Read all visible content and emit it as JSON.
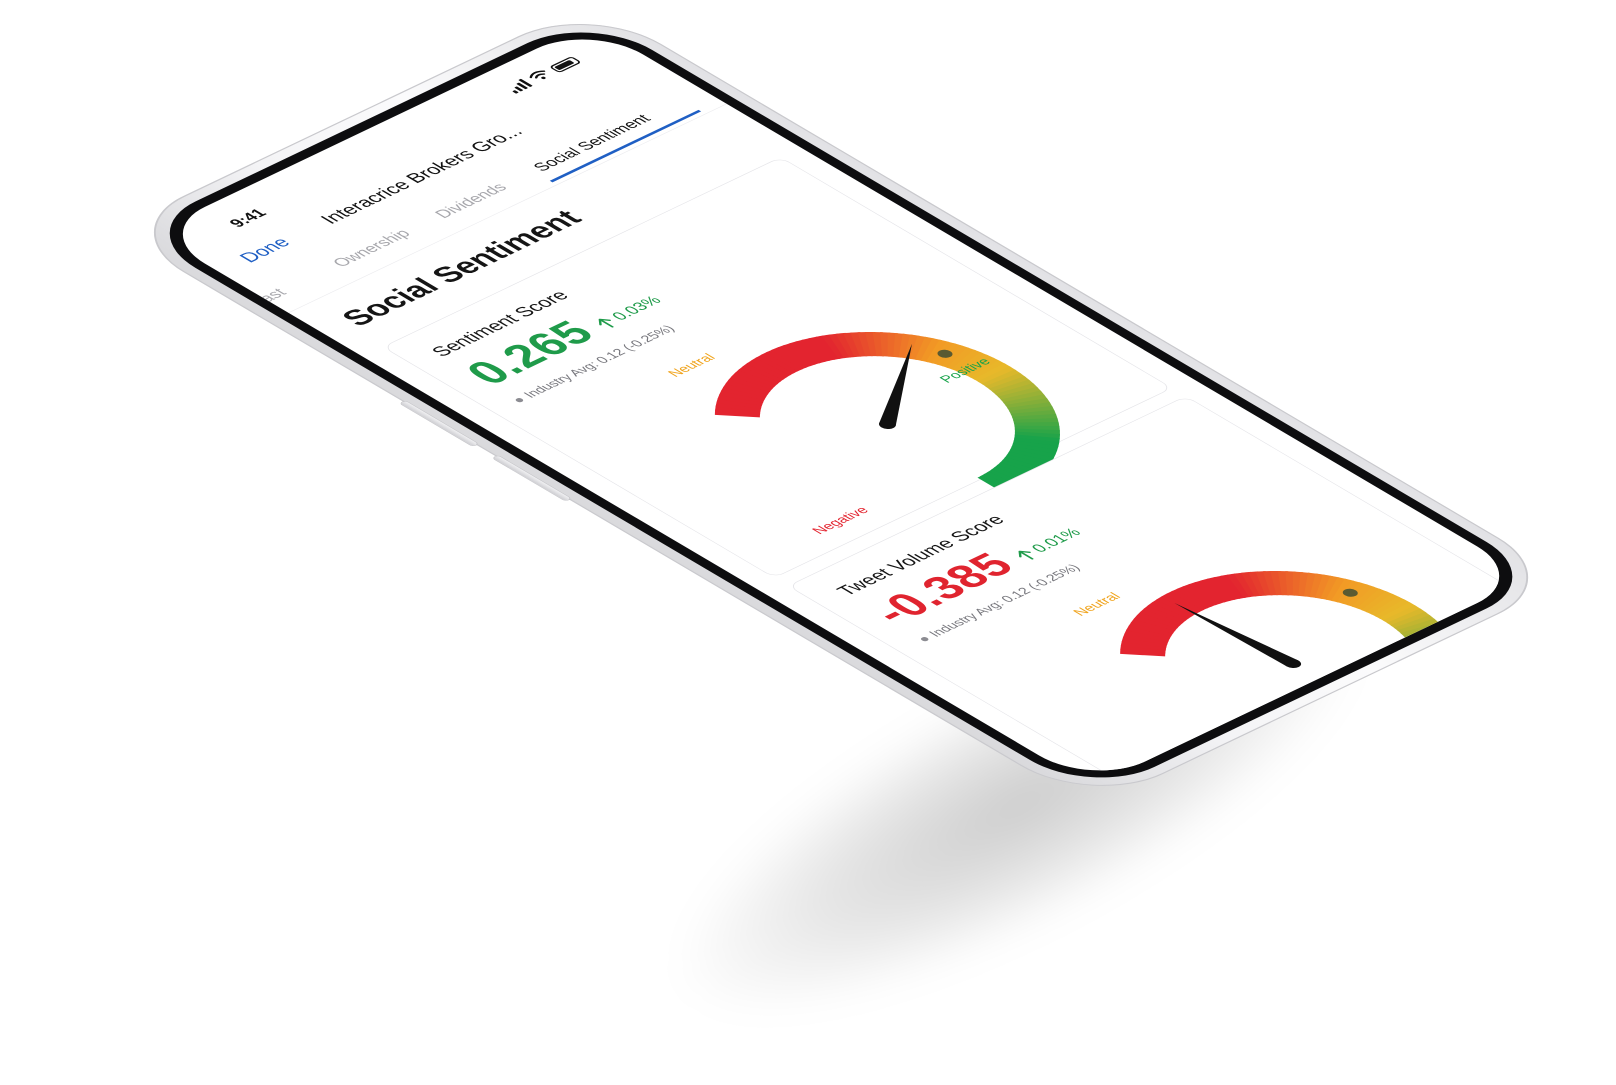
{
  "status_bar": {
    "time": "9:41",
    "icons": [
      "cellular-signal-icon",
      "wifi-icon",
      "battery-icon"
    ]
  },
  "nav": {
    "done_label": "Done",
    "title": "Interacrice Brokers Gro..."
  },
  "tabs": [
    {
      "label": "precast",
      "active": false
    },
    {
      "label": "Ownership",
      "active": false
    },
    {
      "label": "Dividends",
      "active": false
    },
    {
      "label": "Social Sentiment",
      "active": true
    }
  ],
  "section_title": "Social Sentiment",
  "cards": [
    {
      "title": "Sentiment Score",
      "score": "0.265",
      "change": "0.03%",
      "industry_avg": "Industry Avg: 0.12 (-0.25%)",
      "gauge": {
        "labels": {
          "negative": "Negative",
          "neutral": "Neutral",
          "positive": "Positive"
        },
        "needle_position": 0.44,
        "neutral_marker_position": 0.5
      }
    },
    {
      "title": "Tweet Volume Score",
      "score": "-0.385",
      "change": "0.01%",
      "industry_avg": "Industry Avg: 0.12 (-0.25%)",
      "gauge": {
        "labels": {
          "neutral": "Neutral"
        },
        "needle_position": 0.18,
        "neutral_marker_position": 0.5
      }
    }
  ],
  "colors": {
    "accent_blue": "#1f5fc4",
    "positive_green": "#1f9b4a",
    "negative_red": "#e0242f",
    "neutral_orange": "#f0a31b",
    "gauge_red": "#e3242f",
    "gauge_orange": "#f29a25",
    "gauge_yellow": "#e8b92a",
    "gauge_green": "#17a34a"
  }
}
